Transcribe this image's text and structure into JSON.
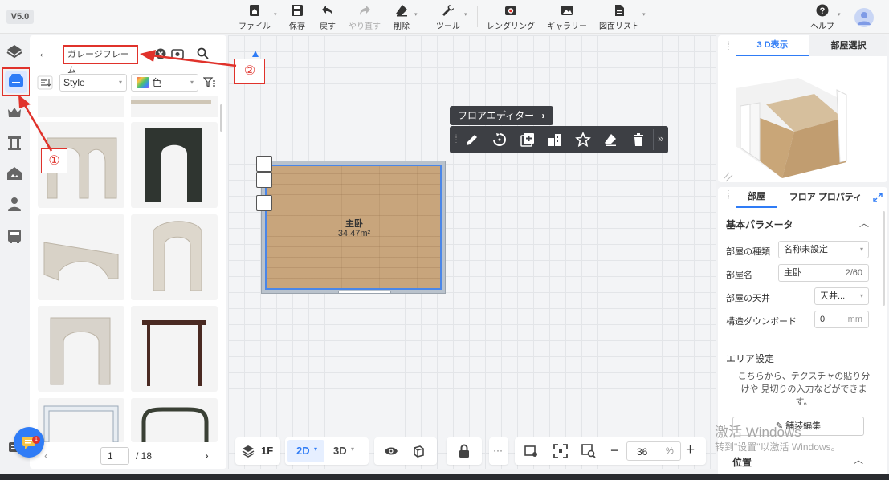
{
  "app": {
    "version": "V5.0"
  },
  "toolbar": {
    "items": [
      {
        "label": "ファイル",
        "icon": "home-icon",
        "has_menu": true
      },
      {
        "label": "保存",
        "icon": "save-icon",
        "has_menu": false
      },
      {
        "label": "戻す",
        "icon": "undo-icon",
        "has_menu": false
      },
      {
        "label": "やり直す",
        "icon": "redo-icon",
        "has_menu": false,
        "disabled": true
      },
      {
        "label": "削除",
        "icon": "eraser-icon",
        "has_menu": true
      },
      {
        "label": "ツール",
        "icon": "wrench-icon",
        "has_menu": true
      },
      {
        "label": "レンダリング",
        "icon": "camera-icon",
        "has_menu": false
      },
      {
        "label": "ギャラリー",
        "icon": "gallery-icon",
        "has_menu": false
      },
      {
        "label": "図面リスト",
        "icon": "document-icon",
        "has_menu": true
      }
    ],
    "help_label": "ヘルプ"
  },
  "library": {
    "search_value": "ガレージフレーム",
    "style_select": "Style",
    "color_select": "色",
    "page_current": "1",
    "page_total": "/ 18"
  },
  "canvas": {
    "floor_editor_label": "フロアエディター",
    "room_name": "主卧",
    "room_area": "34.47m²"
  },
  "bottom_toolbar": {
    "floor": "1F",
    "mode_2d": "2D",
    "mode_3d": "3D",
    "more": "···",
    "zoom_value": "36",
    "zoom_unit": "%"
  },
  "view_panel": {
    "tab_3d": "3 D表示",
    "tab_room_select": "部屋選択"
  },
  "props_panel": {
    "tab_room": "部屋",
    "tab_floor_props": "フロア プロパティ",
    "section_basic": "基本パラメータ",
    "room_type_label": "部屋の種類",
    "room_type_value": "名称未設定",
    "room_name_label": "部屋名",
    "room_name_value": "主卧",
    "room_name_count": "2/60",
    "ceiling_label": "部屋の天井",
    "ceiling_value": "天井...",
    "baseboard_label": "構造ダウンボード",
    "baseboard_value": "0",
    "baseboard_unit": "mm",
    "area_settings_label": "エリア設定",
    "area_settings_desc": "こちらから、テクスチャの貼り分けや 見切りの入力などができます。",
    "decor_edit_button": "舗装編集",
    "position_label": "位置"
  },
  "watermark": {
    "line1": "激活 Windows",
    "line2": "转到\"设置\"以激活 Windows。"
  },
  "annotations": {
    "marker1": "①",
    "marker2": "②"
  },
  "notification_badge": "1",
  "colors": {
    "accent": "#2f7cf6",
    "annotation": "#e0322b",
    "toolbar_dark": "#3d3f44"
  }
}
